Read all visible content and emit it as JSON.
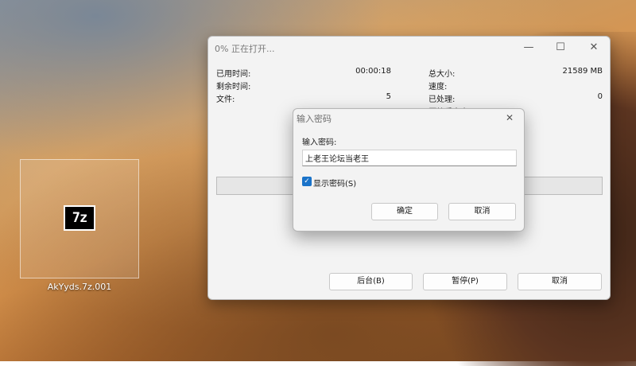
{
  "desktop": {
    "file": {
      "icon_text": "7z",
      "label": "AkYyds.7z.001"
    }
  },
  "main_window": {
    "title": "0% 正在打开...",
    "controls": {
      "minimize": "—",
      "maximize": "☐",
      "close": "✕"
    },
    "stats_left": [
      {
        "label": "已用时间:",
        "value": "00:00:18"
      },
      {
        "label": "剩余时间:",
        "value": ""
      },
      {
        "label": "文件:",
        "value": "5"
      }
    ],
    "stats_right": [
      {
        "label": "总大小:",
        "value": "21589 MB"
      },
      {
        "label": "速度:",
        "value": ""
      },
      {
        "label": "已处理:",
        "value": "0"
      },
      {
        "label": "压缩后大小:",
        "value": ""
      }
    ],
    "progress_percent": 0,
    "buttons": {
      "background": "后台(B)",
      "pause": "暂停(P)",
      "cancel": "取消"
    }
  },
  "password_dialog": {
    "title": "输入密码",
    "close": "✕",
    "label": "输入密码:",
    "password_value": "上老王论坛当老王",
    "show_password_checked": true,
    "show_password_label": "显示密码(S)",
    "ok": "确定",
    "cancel": "取消"
  },
  "colors": {
    "checkbox": "#1a73c9",
    "progress": "#06b025"
  }
}
